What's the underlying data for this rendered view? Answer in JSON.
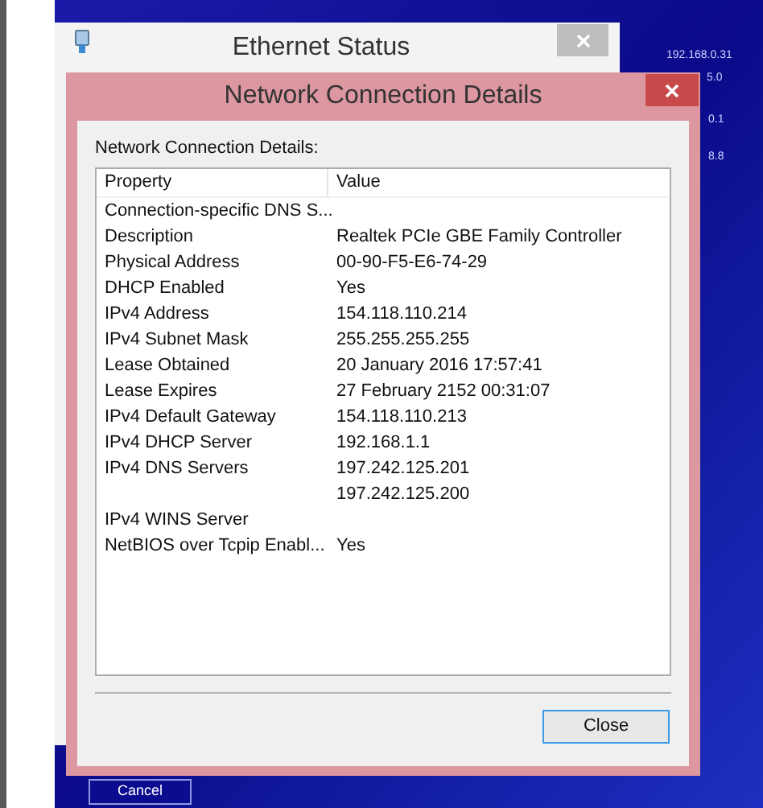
{
  "background_window": {
    "title": "Ethernet Status",
    "cancel_button": "Cancel"
  },
  "desktop_texts": [
    "192.168.0.31",
    "5.0",
    "0.1",
    "8.8"
  ],
  "dialog": {
    "title": "Network Connection Details",
    "label": "Network Connection Details:",
    "columns": [
      "Property",
      "Value"
    ],
    "rows": [
      {
        "property": "Connection-specific DNS S...",
        "value": ""
      },
      {
        "property": "Description",
        "value": "Realtek PCIe GBE Family Controller"
      },
      {
        "property": "Physical Address",
        "value": "00-90-F5-E6-74-29"
      },
      {
        "property": "DHCP Enabled",
        "value": "Yes"
      },
      {
        "property": "IPv4 Address",
        "value": "154.118.110.214"
      },
      {
        "property": "IPv4 Subnet Mask",
        "value": "255.255.255.255"
      },
      {
        "property": "Lease Obtained",
        "value": "20 January 2016 17:57:41"
      },
      {
        "property": "Lease Expires",
        "value": "27 February 2152 00:31:07"
      },
      {
        "property": "IPv4 Default Gateway",
        "value": "154.118.110.213"
      },
      {
        "property": "IPv4 DHCP Server",
        "value": "192.168.1.1"
      },
      {
        "property": "IPv4 DNS Servers",
        "value": "197.242.125.201"
      },
      {
        "property": "",
        "value": "197.242.125.200"
      },
      {
        "property": "IPv4 WINS Server",
        "value": ""
      },
      {
        "property": "NetBIOS over Tcpip Enabl...",
        "value": "Yes"
      }
    ],
    "close_button": "Close"
  }
}
